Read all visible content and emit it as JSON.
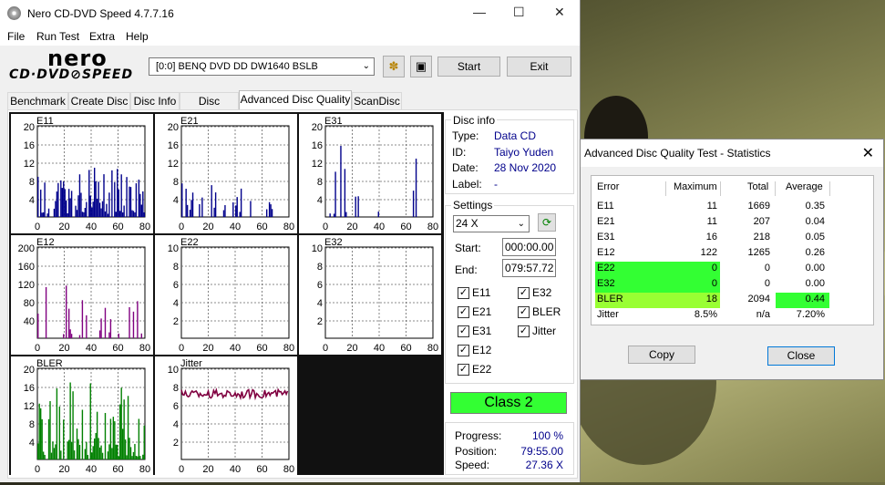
{
  "window": {
    "title": "Nero CD-DVD Speed 4.7.7.16"
  },
  "menu": [
    "File",
    "Run Test",
    "Extra",
    "Help"
  ],
  "logo": {
    "top": "nero",
    "bottom": "CD·DVD⊘SPEED"
  },
  "drive": {
    "selected": "[0:0]   BENQ DVD DD DW1640 BSLB"
  },
  "buttons": {
    "start": "Start",
    "exit": "Exit"
  },
  "tabs": [
    "Benchmark",
    "Create Disc",
    "Disc Info",
    "Disc Quality",
    "Advanced Disc Quality",
    "ScanDisc"
  ],
  "graphs": [
    {
      "name": "E11",
      "yticks": [
        "20",
        "16",
        "12",
        "8",
        "4"
      ],
      "xticks": [
        "0",
        "20",
        "40",
        "60",
        "80"
      ],
      "color": "#00008b",
      "ymax": 20
    },
    {
      "name": "E21",
      "yticks": [
        "20",
        "16",
        "12",
        "8",
        "4"
      ],
      "xticks": [
        "0",
        "20",
        "40",
        "60",
        "80"
      ],
      "color": "#00008b",
      "ymax": 20
    },
    {
      "name": "E31",
      "yticks": [
        "20",
        "16",
        "12",
        "8",
        "4"
      ],
      "xticks": [
        "0",
        "20",
        "40",
        "60",
        "80"
      ],
      "color": "#00008b",
      "ymax": 20
    },
    {
      "name": "E12",
      "yticks": [
        "200",
        "160",
        "120",
        "80",
        "40"
      ],
      "xticks": [
        "0",
        "20",
        "40",
        "60",
        "80"
      ],
      "color": "#800080",
      "ymax": 200
    },
    {
      "name": "E22",
      "yticks": [
        "10",
        "8",
        "6",
        "4",
        "2"
      ],
      "xticks": [
        "0",
        "20",
        "40",
        "60",
        "80"
      ],
      "color": "#800080",
      "ymax": 10
    },
    {
      "name": "E32",
      "yticks": [
        "10",
        "8",
        "6",
        "4",
        "2"
      ],
      "xticks": [
        "0",
        "20",
        "40",
        "60",
        "80"
      ],
      "color": "#800080",
      "ymax": 10
    },
    {
      "name": "BLER",
      "yticks": [
        "20",
        "16",
        "12",
        "8",
        "4"
      ],
      "xticks": [
        "0",
        "20",
        "40",
        "60",
        "80"
      ],
      "color": "#008000",
      "ymax": 20
    },
    {
      "name": "Jitter",
      "yticks": [
        "10",
        "8",
        "6",
        "4",
        "2"
      ],
      "xticks": [
        "0",
        "20",
        "40",
        "60",
        "80"
      ],
      "color": "#800040",
      "ymax": 10
    }
  ],
  "disc_info": {
    "legend": "Disc info",
    "type_label": "Type:",
    "type": "Data CD",
    "id_label": "ID:",
    "id": "Taiyo Yuden",
    "date_label": "Date:",
    "date": "28 Nov 2020",
    "label_label": "Label:",
    "label": "-"
  },
  "settings": {
    "legend": "Settings",
    "speed": "24 X",
    "start_label": "Start:",
    "start": "000:00.00",
    "end_label": "End:",
    "end": "079:57.72",
    "checks": [
      "E11",
      "E32",
      "E21",
      "BLER",
      "E31",
      "Jitter",
      "E12",
      "E22"
    ]
  },
  "class": "Class 2",
  "progress": {
    "progress_label": "Progress:",
    "progress": "100 %",
    "position_label": "Position:",
    "position": "79:55.00",
    "speed_label": "Speed:",
    "speed": "27.36 X"
  },
  "stats_dialog": {
    "title": "Advanced Disc Quality Test - Statistics",
    "headers": [
      "Error",
      "Maximum",
      "Total",
      "Average"
    ],
    "rows": [
      [
        "E11",
        "11",
        "1669",
        "0.35"
      ],
      [
        "E21",
        "11",
        "207",
        "0.04"
      ],
      [
        "E31",
        "16",
        "218",
        "0.05"
      ],
      [
        "E12",
        "122",
        "1265",
        "0.26"
      ],
      [
        "E22",
        "0",
        "0",
        "0.00"
      ],
      [
        "E32",
        "0",
        "0",
        "0.00"
      ],
      [
        "BLER",
        "18",
        "2094",
        "0.44"
      ],
      [
        "Jitter",
        "8.5%",
        "n/a",
        "7.20%"
      ]
    ],
    "copy": "Copy",
    "close": "Close",
    "colors": {
      "green": "#33ff33",
      "lime": "#99ff33"
    }
  }
}
